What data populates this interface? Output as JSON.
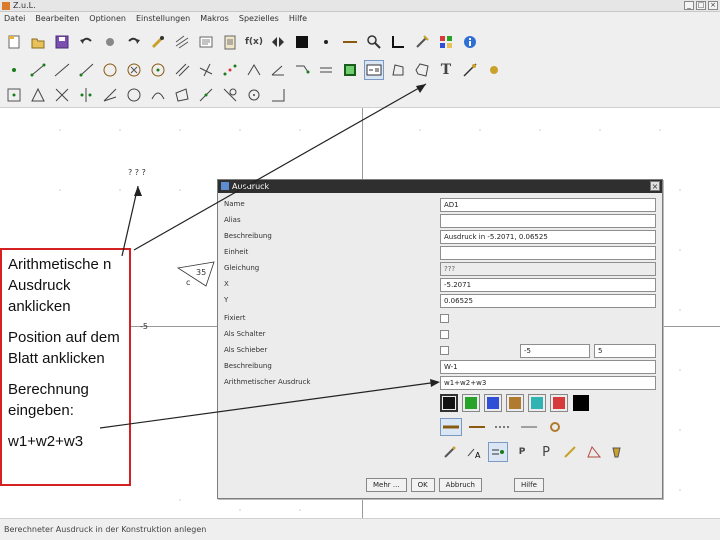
{
  "app": {
    "title": "Z.u.L."
  },
  "menu": [
    "Datei",
    "Bearbeiten",
    "Optionen",
    "Einstellungen",
    "Makros",
    "Spezielles",
    "Hilfe"
  ],
  "window_buttons": [
    "_",
    "□",
    "×"
  ],
  "toolbar1": [
    "new-file-icon",
    "open-file-icon",
    "save-icon",
    "undo-icon",
    "redo-icon",
    "hide-icon",
    "color-icon",
    "grid-icon",
    "comment-icon",
    "formula-icon",
    "arrow-icon",
    "square-icon",
    "point-icon",
    "line-style-icon",
    "zoom-icon",
    "axis-icon",
    "tools-icon",
    "palette-icon",
    "info-icon"
  ],
  "toolbar2": [
    "point-icon",
    "segment-icon",
    "line-icon",
    "ray-icon",
    "circle-icon",
    "circle-fixed-icon",
    "circle3-icon",
    "parallel-icon",
    "perpendicular-icon",
    "midpoint-icon",
    "angle-icon",
    "angle-fixed-icon",
    "move-icon",
    "expression-icon",
    "polygon-icon",
    "text-icon",
    "tracker-icon",
    "animate-icon"
  ],
  "toolbar3": [
    "intersection-icon",
    "triangle-icon",
    "mirror-icon",
    "reflect-icon",
    "circle-tool-icon",
    "arc-icon",
    "bisector-icon",
    "quadrilateral-icon",
    "transform-icon",
    "locus-icon"
  ],
  "canvas": {
    "label_top": "? ? ?",
    "label_angle": "35",
    "label_c": "c",
    "label_axis": "-5"
  },
  "status": {
    "text": "Berechneter Ausdruck in der Konstruktion anlegen"
  },
  "annotation": {
    "line1": "Arithmetische n Ausdruck anklicken",
    "line2": "Position auf dem Blatt anklicken",
    "line3": "Berechnung eingeben:",
    "line4": "w1+w2+w3"
  },
  "dialog": {
    "title": "Ausdruck",
    "fields": {
      "name": {
        "label": "Name",
        "value": "AD1"
      },
      "alias": {
        "label": "Alias",
        "value": ""
      },
      "description": {
        "label": "Beschreibung",
        "value": "Ausdruck in -5.2071, 0.06525"
      },
      "unit": {
        "label": "Einheit",
        "value": ""
      },
      "equation": {
        "label": "Gleichung",
        "value": "???"
      },
      "x": {
        "label": "X",
        "value": "-5.2071"
      },
      "y": {
        "label": "Y",
        "value": "0.06525"
      },
      "fixed": {
        "label": "Fixiert"
      },
      "as_switch": {
        "label": "Als Schalter"
      },
      "as_slider": {
        "label": "Als Schieber",
        "min": "-5",
        "max": "5"
      },
      "explanation": {
        "label": "Beschreibung",
        "value": "W-1"
      },
      "expression": {
        "label": "Arithmetischer Ausdruck",
        "value": "w1+w2+w3"
      }
    },
    "colors": [
      "#111111",
      "#27a327",
      "#2e4fd6",
      "#b07b2e",
      "#2fb3b3",
      "#d63a3a",
      "#000000"
    ],
    "line_styles": [
      "thick",
      "medium",
      "dotted",
      "thin",
      "ring"
    ],
    "point_types": [
      "pen-icon",
      "A-icon",
      "toggle-icon",
      "P-small",
      "P-large",
      "brush-icon",
      "angle-tool-icon",
      "bucket-icon"
    ],
    "buttons": {
      "more": "Mehr ...",
      "ok": "OK",
      "cancel": "Abbruch",
      "help": "Hilfe"
    }
  }
}
